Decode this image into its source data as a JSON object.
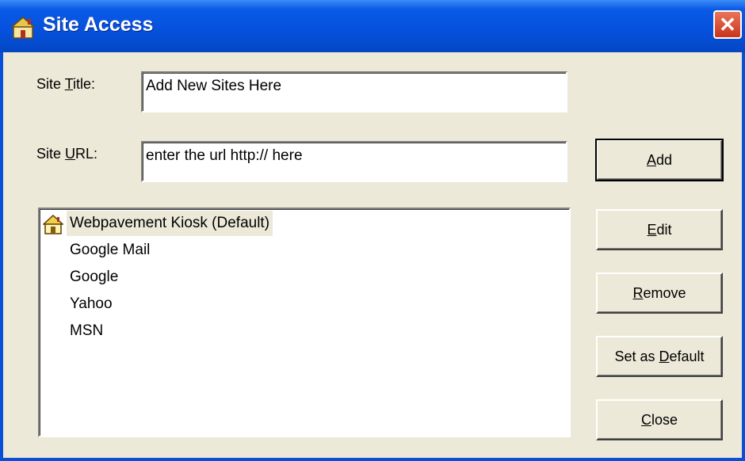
{
  "window": {
    "title": "Site Access",
    "close_glyph": "✕"
  },
  "form": {
    "site_title": {
      "label_prefix": "Site ",
      "label_mnemonic": "T",
      "label_suffix": "itle:",
      "value": "Add New Sites Here"
    },
    "site_url": {
      "label_prefix": "Site ",
      "label_mnemonic": "U",
      "label_suffix": "RL:",
      "value": "enter the url http:// here"
    }
  },
  "sites": {
    "default_item": "Webpavement Kiosk (Default)",
    "items": [
      "Google Mail",
      "Google",
      "Yahoo",
      "MSN"
    ]
  },
  "buttons": {
    "add": {
      "prefix": "",
      "mnemonic": "A",
      "suffix": "dd"
    },
    "edit": {
      "prefix": "",
      "mnemonic": "E",
      "suffix": "dit"
    },
    "remove": {
      "prefix": "",
      "mnemonic": "R",
      "suffix": "emove"
    },
    "set_default": {
      "prefix": "Set as ",
      "mnemonic": "D",
      "suffix": "efault"
    },
    "close": {
      "prefix": "",
      "mnemonic": "C",
      "suffix": "lose"
    }
  },
  "icons": {
    "title": "home-icon",
    "default_site": "home-icon",
    "close": "close-icon"
  },
  "colors": {
    "titlebar": "#0550dc",
    "dialog_bg": "#ece9d8",
    "close_button": "#c9341b",
    "selection_bg": "#ece9d8"
  }
}
